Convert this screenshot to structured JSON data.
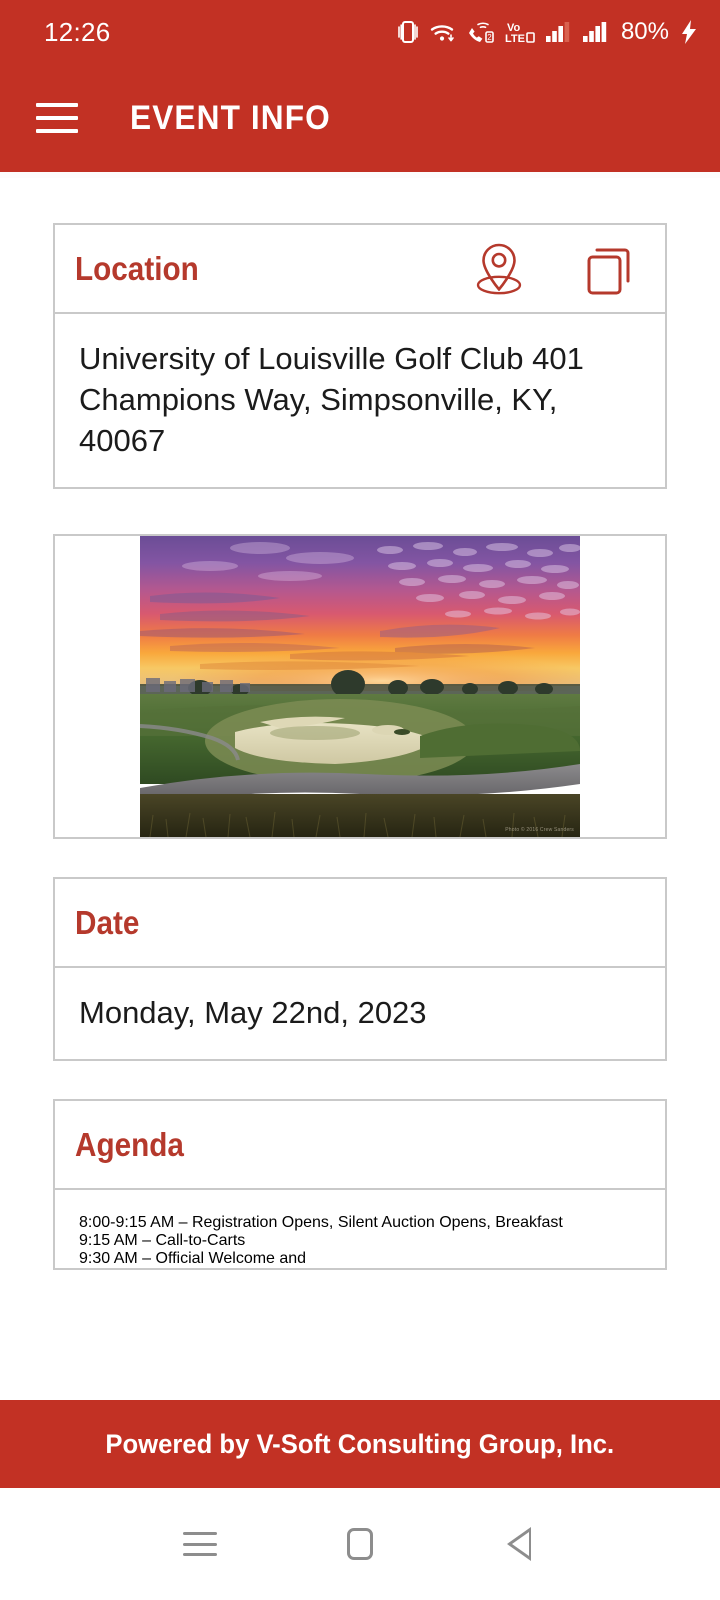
{
  "status_bar": {
    "clock": "12:26",
    "battery_percent": "80%",
    "icons": [
      "vibrate-icon",
      "wifi-icon",
      "call-forwarding-icon",
      "volte-icon",
      "signal-sim1-icon",
      "signal-sim2-icon",
      "charging-bolt-icon"
    ]
  },
  "app_bar": {
    "menu_icon": "hamburger-menu-icon",
    "title": "EVENT INFO"
  },
  "theme": {
    "brand_red": "#c23124",
    "title_red": "#b5392c",
    "card_border": "#c9c9c9",
    "body_text": "#1b1b1b"
  },
  "cards": {
    "location": {
      "title": "Location",
      "icons": [
        "map-pin-icon",
        "copy-icon"
      ],
      "address": "University of Louisville Golf Club 401 Champions Way, Simpsonville, KY, 40067"
    },
    "photo": {
      "alt": "golf-course-sunset-photo",
      "watermark": "Photo © 2016 Crew Sanders"
    },
    "date": {
      "title": "Date",
      "value": "Monday, May 22nd, 2023"
    },
    "agenda": {
      "title": "Agenda",
      "lines": [
        "8:00-9:15 AM – Registration Opens, Silent Auction Opens,  Breakfast",
        "9:15 AM – Call-to-Carts",
        "9:30 AM – Official Welcome and"
      ],
      "text": "8:00-9:15 AM – Registration Opens, Silent Auction Opens,  Breakfast\n9:15 AM – Call-to-Carts\n9:30 AM – Official Welcome and"
    }
  },
  "footer": {
    "text": "Powered by V-Soft Consulting Group, Inc."
  },
  "nav_bar": {
    "recents_label": "recents-icon",
    "home_label": "home-icon",
    "back_label": "back-icon"
  }
}
